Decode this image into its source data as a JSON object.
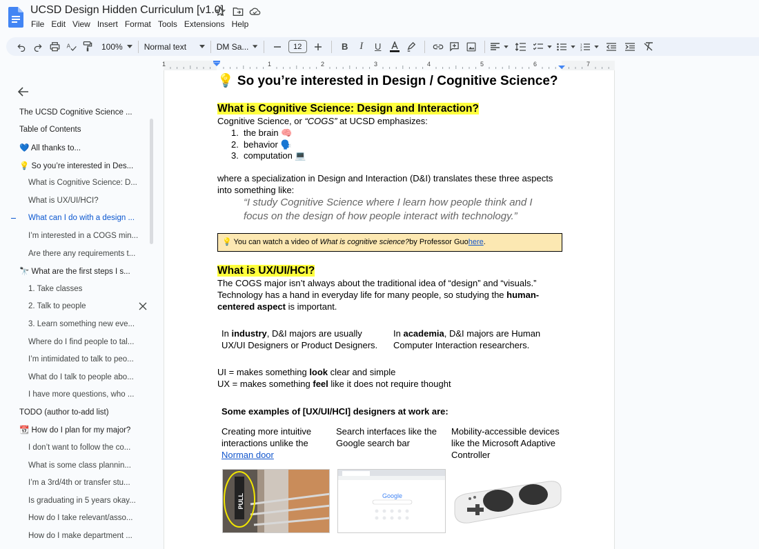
{
  "doc": {
    "title": "UCSD Design Hidden Curriculum [v1.0]"
  },
  "menu": [
    "File",
    "Edit",
    "View",
    "Insert",
    "Format",
    "Tools",
    "Extensions",
    "Help"
  ],
  "toolbar": {
    "zoom": "100%",
    "style": "Normal text",
    "font": "DM Sa...",
    "font_size": "12"
  },
  "ruler": [
    "1",
    "1",
    "2",
    "3",
    "4",
    "5",
    "6",
    "7"
  ],
  "outline": [
    {
      "label": "The UCSD Cognitive Science ...",
      "level": 1
    },
    {
      "label": "Table of Contents",
      "level": 1
    },
    {
      "label": "💙 All thanks to...",
      "level": 1
    },
    {
      "label": "💡 So you’re interested in Des...",
      "level": 1
    },
    {
      "label": "What is Cognitive Science: D...",
      "level": 2
    },
    {
      "label": "What is UX/UI/HCI?",
      "level": 2
    },
    {
      "label": "What can I do with a design ...",
      "level": 2,
      "active": true
    },
    {
      "label": "I’m interested in a COGS min...",
      "level": 2
    },
    {
      "label": "Are there any requirements t...",
      "level": 2
    },
    {
      "label": "🔭 What are the first steps I s...",
      "level": 1
    },
    {
      "label": "1. Take classes",
      "level": 2
    },
    {
      "label": "2. Talk to people",
      "level": 2,
      "hover": true
    },
    {
      "label": "3. Learn something new eve...",
      "level": 2
    },
    {
      "label": "Where do I find people to tal...",
      "level": 2
    },
    {
      "label": "I’m intimidated to talk to peo...",
      "level": 2
    },
    {
      "label": "What do I talk to people abo...",
      "level": 2
    },
    {
      "label": "I have more questions, who ...",
      "level": 2
    },
    {
      "label": "TODO (author to-add list)",
      "level": 1
    },
    {
      "label": "📆 How do I plan for my major?",
      "level": 1
    },
    {
      "label": "I don’t want to follow the co...",
      "level": 2
    },
    {
      "label": "What is some class plannin...",
      "level": 2
    },
    {
      "label": "I’m a 3rd/4th or transfer stu...",
      "level": 2
    },
    {
      "label": "Is graduating in 5 years okay...",
      "level": 2
    },
    {
      "label": "How do I take relevant/asso...",
      "level": 2
    },
    {
      "label": "How do I make department ...",
      "level": 2
    }
  ],
  "body": {
    "h1": "💡 So you’re interested in Design / Cognitive Science?",
    "h2_cogs": "What is Cognitive Science: Design and Interaction?",
    "cogs_intro_a": "Cognitive Science, or ",
    "cogs_intro_b": "“COGS”",
    "cogs_intro_c": " at UCSD emphasizes:",
    "list": [
      {
        "num": "1.",
        "text": "the brain 🧠"
      },
      {
        "num": "2.",
        "text": "behavior 🗣️"
      },
      {
        "num": "3.",
        "text": "computation 💻"
      }
    ],
    "para_di": "where a specialization in Design and Interaction (D&I) translates these three aspects into something like:",
    "quote": "“I study Cognitive Science where I learn how people think and I focus on the design of how people interact with technology.”",
    "callout_a": "💡 You can watch a video of ",
    "callout_b": "What is cognitive science?",
    "callout_c": " by Professor Guo ",
    "callout_link": "here",
    "callout_d": ".",
    "h2_ux": "What is UX/UI/HCI?",
    "para_ux_a": "The COGS major isn’t always about the traditional idea of “design” and “visuals.” Technology has a hand in everyday life for many people, so studying the ",
    "para_ux_b": "human-centered aspect",
    "para_ux_c": " is important.",
    "industry_a": "In ",
    "industry_b": "industry",
    "industry_c": ", D&I majors are usually UX/UI Designers or Product Designers.",
    "academia_a": "In ",
    "academia_b": "academia",
    "academia_c": ", D&I majors are Human Computer Interaction researchers.",
    "ui_a": "UI = makes something ",
    "ui_b": "look",
    "ui_c": " clear and simple",
    "ux_a": "UX = makes something ",
    "ux_b": "feel",
    "ux_c": " like it does not require thought",
    "examples_title": "Some examples of [UX/UI/HCI] designers at work are:",
    "ex1_a": "Creating more intuitive interactions unlike the ",
    "ex1_link": "Norman door",
    "ex2": "Search interfaces like the Google search bar",
    "ex3": "Mobility-accessible devices like the Microsoft Adaptive Controller",
    "img1_text": "PULL",
    "img2_text": "Google"
  },
  "colors": {
    "highlight": "#ffff3d",
    "callout_bg": "#fce8b2",
    "link": "#1155cc",
    "active": "#0b57d0"
  }
}
